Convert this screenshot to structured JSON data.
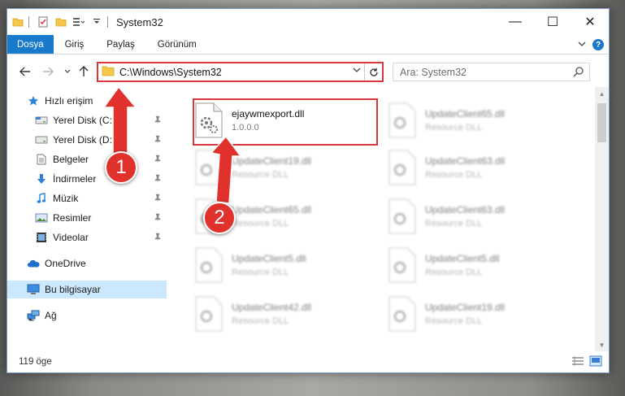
{
  "window": {
    "title": "System32",
    "controls": {
      "minimize": "—",
      "maximize": "☐",
      "close": "✕"
    }
  },
  "ribbon": {
    "tabs": [
      {
        "label": "Dosya",
        "active": true
      },
      {
        "label": "Giriş"
      },
      {
        "label": "Paylaş"
      },
      {
        "label": "Görünüm"
      }
    ],
    "expand_icon": "chevron-down-icon",
    "help_label": "?"
  },
  "nav": {
    "back_icon": "arrow-left-icon",
    "forward_icon": "arrow-right-icon",
    "recent_icon": "chevron-down-icon",
    "up_icon": "arrow-up-icon"
  },
  "address": {
    "path": "C:\\Windows\\System32"
  },
  "search": {
    "placeholder": "Ara: System32"
  },
  "sidebar": {
    "items": [
      {
        "label": "Hızlı erişim",
        "icon": "star-icon",
        "pinned": false
      },
      {
        "label": "Yerel Disk (C:)",
        "icon": "drive-icon",
        "pinned": true
      },
      {
        "label": "Yerel Disk (D:)",
        "icon": "drive-icon",
        "pinned": true
      },
      {
        "label": "Belgeler",
        "icon": "document-icon",
        "pinned": true
      },
      {
        "label": "İndirmeler",
        "icon": "download-icon",
        "pinned": true
      },
      {
        "label": "Müzik",
        "icon": "music-icon",
        "pinned": true
      },
      {
        "label": "Resimler",
        "icon": "pictures-icon",
        "pinned": true
      },
      {
        "label": "Videolar",
        "icon": "video-icon",
        "pinned": true
      },
      {
        "label": "OneDrive",
        "icon": "cloud-icon",
        "pinned": false
      },
      {
        "label": "Bu bilgisayar",
        "icon": "computer-icon",
        "pinned": false,
        "selected": true
      },
      {
        "label": "Ağ",
        "icon": "network-icon",
        "pinned": false
      }
    ]
  },
  "files": [
    {
      "name": "ejaywmexport.dll",
      "desc": "1.0.0.0",
      "highlighted": true
    },
    {
      "name": "UpdateClient65.dll",
      "desc": "Resource DLL"
    },
    {
      "name": "UpdateClient19.dll",
      "desc": "Resource DLL"
    },
    {
      "name": "UpdateClient63.dll",
      "desc": "Resource DLL"
    },
    {
      "name": "UpdateClient65.dll",
      "desc": "Resource DLL"
    },
    {
      "name": "UpdateClient63.dll",
      "desc": "Resource DLL"
    },
    {
      "name": "UpdateClient5.dll",
      "desc": "Resource DLL"
    },
    {
      "name": "UpdateClient5.dll",
      "desc": "Resource DLL"
    },
    {
      "name": "UpdateClient42.dll",
      "desc": "Resource DLL"
    },
    {
      "name": "UpdateClient19.dll",
      "desc": "Resource DLL"
    }
  ],
  "status": {
    "item_count": "119 öge"
  },
  "annotations": {
    "step1": "1",
    "step2": "2",
    "color": "#e0312d"
  }
}
